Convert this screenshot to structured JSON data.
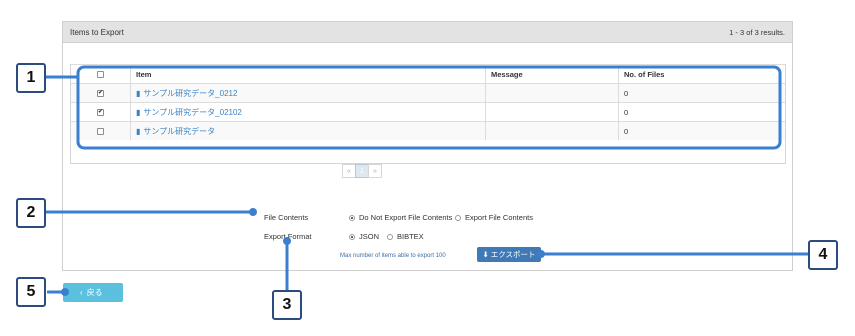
{
  "panel": {
    "title": "Items to Export",
    "results": "1 - 3 of 3 results."
  },
  "table": {
    "headers": {
      "item": "Item",
      "message": "Message",
      "files": "No. of Files"
    },
    "rows": [
      {
        "checked": true,
        "item": "サンプル研究データ_0212",
        "message": "",
        "files": "0"
      },
      {
        "checked": true,
        "item": "サンプル研究データ_02102",
        "message": "",
        "files": "0"
      },
      {
        "checked": false,
        "item": "サンプル研究データ",
        "message": "",
        "files": "0"
      }
    ]
  },
  "pagination": {
    "prev": "«",
    "current": "1",
    "next": "»"
  },
  "form": {
    "file_contents_label": "File Contents",
    "file_option_1": "Do Not Export File Contents",
    "file_option_2": "Export File Contents",
    "export_format_label": "Export Format",
    "format_option_1": "JSON",
    "format_option_2": "BIBTEX",
    "max_note": "Max number of items able to export 100"
  },
  "export_button": "エクスポート",
  "back_button": "戻る",
  "callouts": [
    "1",
    "2",
    "3",
    "4",
    "5"
  ],
  "colors": {
    "outline": "#3a7fd0",
    "export": "#3f7ab7",
    "back": "#5bc0de"
  }
}
